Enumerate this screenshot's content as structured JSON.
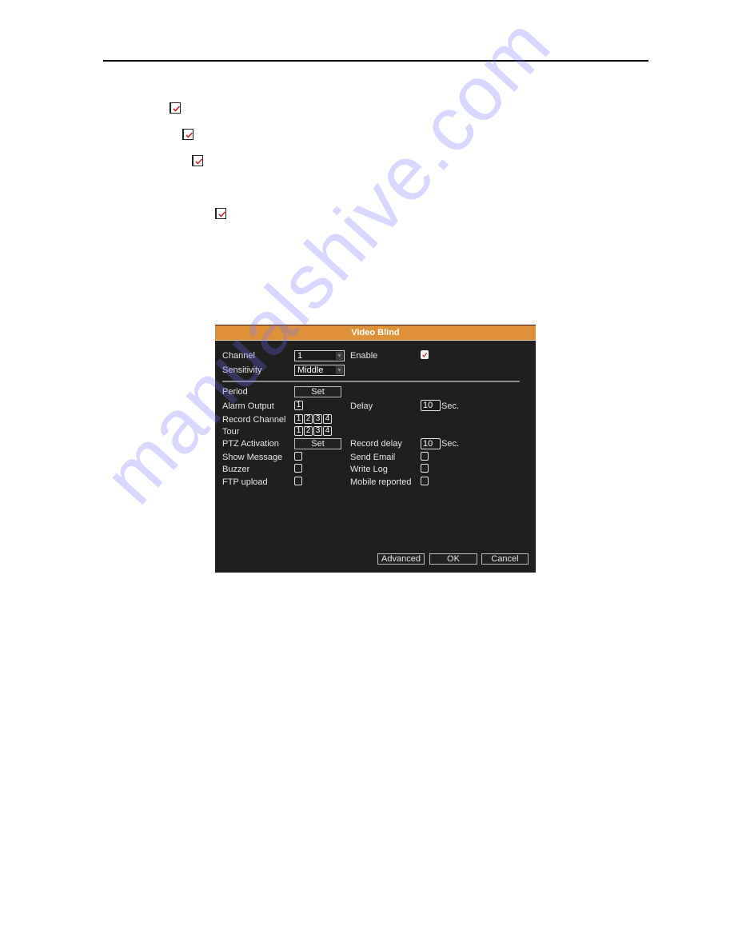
{
  "page": {
    "doc_checkboxes": [
      {
        "name": "doc-checkbox-1",
        "checked": true
      },
      {
        "name": "doc-checkbox-2",
        "checked": true
      },
      {
        "name": "doc-checkbox-3",
        "checked": true
      },
      {
        "name": "doc-checkbox-4",
        "checked": true
      }
    ],
    "watermark": "manualshive.com"
  },
  "dialog": {
    "title": "Video Blind",
    "channel": {
      "label": "Channel",
      "value": "1"
    },
    "sensitivity": {
      "label": "Sensitivity",
      "value": "Middle"
    },
    "enable": {
      "label": "Enable",
      "checked": true
    },
    "period": {
      "label": "Period",
      "button": "Set"
    },
    "alarm_output": {
      "label": "Alarm Output",
      "channels": [
        "1"
      ]
    },
    "delay": {
      "label": "Delay",
      "value": "10",
      "unit": "Sec."
    },
    "record_channel": {
      "label": "Record Channel",
      "channels": [
        "1",
        "2",
        "3",
        "4"
      ]
    },
    "tour": {
      "label": "Tour",
      "channels": [
        "1",
        "2",
        "3",
        "4"
      ]
    },
    "ptz_activation": {
      "label": "PTZ Activation",
      "button": "Set"
    },
    "record_delay": {
      "label": "Record delay",
      "value": "10",
      "unit": "Sec."
    },
    "show_message": {
      "label": "Show Message",
      "checked": false
    },
    "send_email": {
      "label": "Send Email",
      "checked": false
    },
    "buzzer": {
      "label": "Buzzer",
      "checked": false
    },
    "write_log": {
      "label": "Write Log",
      "checked": false
    },
    "ftp_upload": {
      "label": "FTP upload",
      "checked": false
    },
    "mobile_reported": {
      "label": "Mobile reported",
      "checked": false
    },
    "buttons": {
      "advanced": "Advanced",
      "ok": "OK",
      "cancel": "Cancel"
    },
    "colors": {
      "header": "#dd9038",
      "body": "#1f1f1f",
      "text": "#e6e6e6"
    }
  }
}
